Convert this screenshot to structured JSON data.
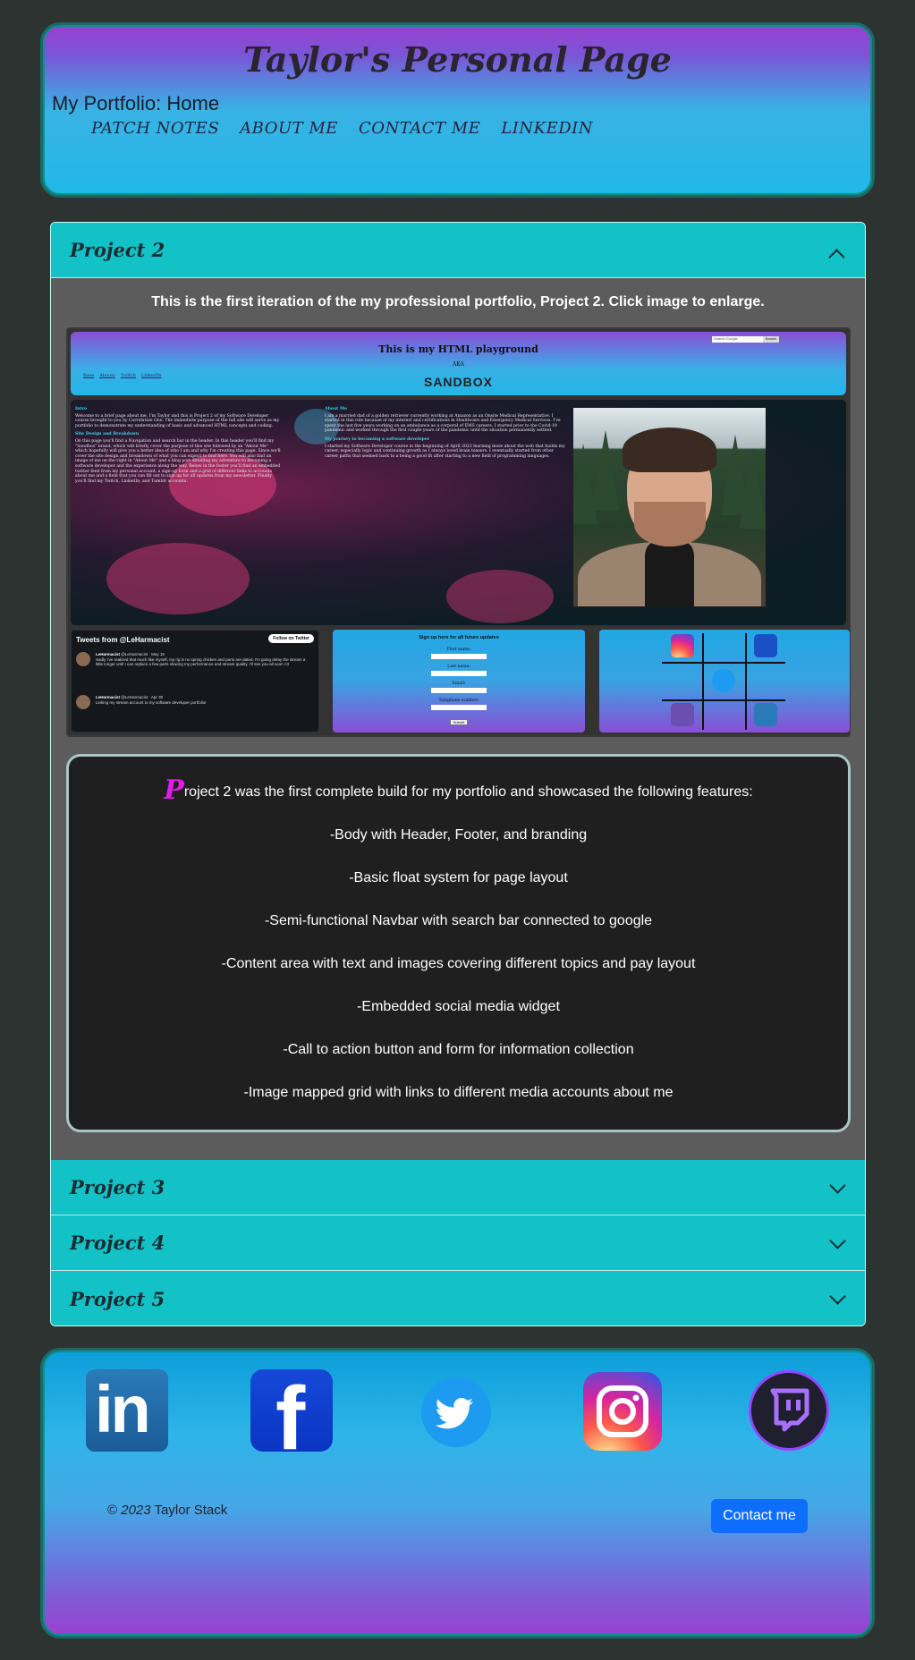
{
  "header": {
    "title": "Taylor's Personal Page",
    "subtitle": "My Portfolio: Home",
    "nav": [
      "PATCH NOTES",
      "ABOUT ME",
      "CONTACT ME",
      "LINKEDIN"
    ]
  },
  "accordion": {
    "items": [
      {
        "title": "Project 2",
        "expanded": true
      },
      {
        "title": "Project 3",
        "expanded": false
      },
      {
        "title": "Project 4",
        "expanded": false
      },
      {
        "title": "Project 5",
        "expanded": false
      }
    ],
    "intro": "This is the first iteration of the my professional portfolio, Project 2. Click image to enlarge."
  },
  "thumbnail": {
    "title": "This is my HTML playground",
    "aka": "AKA",
    "logo": "SANDBOX",
    "search_placeholder": "Search Google",
    "search_btn": "Search",
    "nav": [
      "Base",
      "Abouts",
      "Twitch",
      "LinkedIn"
    ],
    "intro_heading": "Intro",
    "intro_text": "Welcome to a brief page about me, I'm Taylor and this is Project 2 of my Software Developer course brought to you by Correlation One. The immediate purpose of the full site will serve as my portfolio to demonstrate my understanding of basic and advanced HTML concepts and coding.",
    "design_heading": "Site Design and Breakdown",
    "design_text": "On this page you'll find a Navigation and search bar in the header. In this header you'll find my \"Sandbox\" brand, which will briefly cover the purpose of this site followed by an \"About Me\" which hopefully will give you a better idea of who I am and why I'm creating this page. Since we'll cover the site design and breakdown of what you can expect to find here. You will also find an image of me on the right in \"About Me\" and a blog post detailing my adventure to becoming a software developer and the experience along the way. Below in the footer you'll find an embedded twitter feed from my personal account, a sign-up form and a grid of different links to accounts about me and a field that you can fill out to sign up for all updates from my newsletter. Finally you'll find my Twitch, LinkedIn, and Tumblr accounts.",
    "about_heading": "About Me",
    "about_text": "I am a married dad of a golden retriever currently working at Amazon as an Onsite Medical Representative. I started in this role because of my interest and certifications in Healthcare and Emergency Medical Services. I've spent the last five years working on an ambulance as a corporal of EMS careers. I started prior to the Covid-19 pandemic and worked through the first couple years of the pandemic until the situation permanently settled.",
    "journey_heading": "My journey to becoming a software developer",
    "journey_text": "I started my Software Developer course in the beginning of April 2023 learning more about the web that builds my career, especially logic and continuing growth as I always loved brain teasers. I eventually started from other career paths that seemed back to a being a good fit after starting to a new field of programming languages.",
    "tweets_header": "Tweets from @LeHarmacist",
    "follow_btn": "Follow on Twitter",
    "tweets": [
      {
        "name": "LeHarmacist",
        "handle": "@LeHarmacist · May 15",
        "text": "Sadly I've realized that much like myself, my rig is no spring chicken and parts are dated. I'm going delay the stream a little longer until I can replace a few parts slowing my performance and stream quality. I'll see you all soon <3"
      },
      {
        "name": "LeHarmacist",
        "handle": "@LeHarmacist · Apr 30",
        "text": "Linking my stream account to my software developer portfolio!"
      }
    ],
    "form_title": "Sign up here for all future updates",
    "form_labels": [
      "First name:",
      "Last name:",
      "Email:",
      "Telephone number:"
    ],
    "form_submit": "Submit"
  },
  "features": {
    "drop_cap": "P",
    "lead": "roject 2 was the first complete build for my portfolio and showcased the following features:",
    "items": [
      "-Body with Header, Footer, and branding",
      "-Basic float system for page layout",
      "-Semi-functional Navbar with search bar connected to google",
      "-Content area with text and images covering different topics and pay layout",
      "-Embedded social media widget",
      "-Call to action button and form for information collection",
      "-Image mapped grid with links to different media accounts about me"
    ]
  },
  "footer": {
    "social": [
      "linkedin-icon",
      "facebook-icon",
      "twitter-icon",
      "instagram-icon",
      "twitch-icon"
    ],
    "copyright_symbol": "©",
    "copyright_year": "2023",
    "copyright_name": "Taylor Stack",
    "contact_btn": "Contact me"
  },
  "colors": {
    "accent": "#13c2c6",
    "background": "#2c3331",
    "button": "#0d6efd",
    "header_gradient_top": "#9a3fd0",
    "header_gradient_bottom": "#20b8e8",
    "drop_cap": "#e01ee8"
  }
}
